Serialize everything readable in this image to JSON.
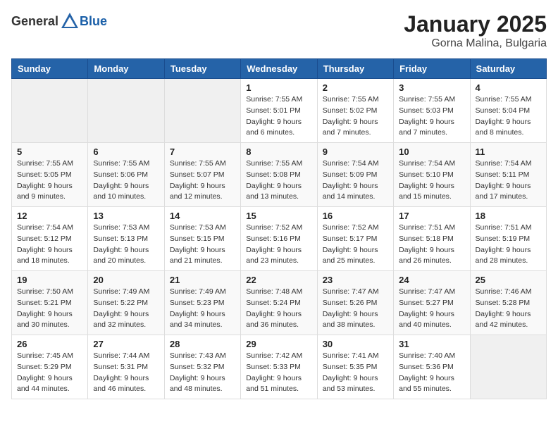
{
  "logo": {
    "general": "General",
    "blue": "Blue"
  },
  "header": {
    "month": "January 2025",
    "location": "Gorna Malina, Bulgaria"
  },
  "weekdays": [
    "Sunday",
    "Monday",
    "Tuesday",
    "Wednesday",
    "Thursday",
    "Friday",
    "Saturday"
  ],
  "weeks": [
    [
      {
        "day": "",
        "sunrise": "",
        "sunset": "",
        "daylight": ""
      },
      {
        "day": "",
        "sunrise": "",
        "sunset": "",
        "daylight": ""
      },
      {
        "day": "",
        "sunrise": "",
        "sunset": "",
        "daylight": ""
      },
      {
        "day": "1",
        "sunrise": "Sunrise: 7:55 AM",
        "sunset": "Sunset: 5:01 PM",
        "daylight": "Daylight: 9 hours and 6 minutes."
      },
      {
        "day": "2",
        "sunrise": "Sunrise: 7:55 AM",
        "sunset": "Sunset: 5:02 PM",
        "daylight": "Daylight: 9 hours and 7 minutes."
      },
      {
        "day": "3",
        "sunrise": "Sunrise: 7:55 AM",
        "sunset": "Sunset: 5:03 PM",
        "daylight": "Daylight: 9 hours and 7 minutes."
      },
      {
        "day": "4",
        "sunrise": "Sunrise: 7:55 AM",
        "sunset": "Sunset: 5:04 PM",
        "daylight": "Daylight: 9 hours and 8 minutes."
      }
    ],
    [
      {
        "day": "5",
        "sunrise": "Sunrise: 7:55 AM",
        "sunset": "Sunset: 5:05 PM",
        "daylight": "Daylight: 9 hours and 9 minutes."
      },
      {
        "day": "6",
        "sunrise": "Sunrise: 7:55 AM",
        "sunset": "Sunset: 5:06 PM",
        "daylight": "Daylight: 9 hours and 10 minutes."
      },
      {
        "day": "7",
        "sunrise": "Sunrise: 7:55 AM",
        "sunset": "Sunset: 5:07 PM",
        "daylight": "Daylight: 9 hours and 12 minutes."
      },
      {
        "day": "8",
        "sunrise": "Sunrise: 7:55 AM",
        "sunset": "Sunset: 5:08 PM",
        "daylight": "Daylight: 9 hours and 13 minutes."
      },
      {
        "day": "9",
        "sunrise": "Sunrise: 7:54 AM",
        "sunset": "Sunset: 5:09 PM",
        "daylight": "Daylight: 9 hours and 14 minutes."
      },
      {
        "day": "10",
        "sunrise": "Sunrise: 7:54 AM",
        "sunset": "Sunset: 5:10 PM",
        "daylight": "Daylight: 9 hours and 15 minutes."
      },
      {
        "day": "11",
        "sunrise": "Sunrise: 7:54 AM",
        "sunset": "Sunset: 5:11 PM",
        "daylight": "Daylight: 9 hours and 17 minutes."
      }
    ],
    [
      {
        "day": "12",
        "sunrise": "Sunrise: 7:54 AM",
        "sunset": "Sunset: 5:12 PM",
        "daylight": "Daylight: 9 hours and 18 minutes."
      },
      {
        "day": "13",
        "sunrise": "Sunrise: 7:53 AM",
        "sunset": "Sunset: 5:13 PM",
        "daylight": "Daylight: 9 hours and 20 minutes."
      },
      {
        "day": "14",
        "sunrise": "Sunrise: 7:53 AM",
        "sunset": "Sunset: 5:15 PM",
        "daylight": "Daylight: 9 hours and 21 minutes."
      },
      {
        "day": "15",
        "sunrise": "Sunrise: 7:52 AM",
        "sunset": "Sunset: 5:16 PM",
        "daylight": "Daylight: 9 hours and 23 minutes."
      },
      {
        "day": "16",
        "sunrise": "Sunrise: 7:52 AM",
        "sunset": "Sunset: 5:17 PM",
        "daylight": "Daylight: 9 hours and 25 minutes."
      },
      {
        "day": "17",
        "sunrise": "Sunrise: 7:51 AM",
        "sunset": "Sunset: 5:18 PM",
        "daylight": "Daylight: 9 hours and 26 minutes."
      },
      {
        "day": "18",
        "sunrise": "Sunrise: 7:51 AM",
        "sunset": "Sunset: 5:19 PM",
        "daylight": "Daylight: 9 hours and 28 minutes."
      }
    ],
    [
      {
        "day": "19",
        "sunrise": "Sunrise: 7:50 AM",
        "sunset": "Sunset: 5:21 PM",
        "daylight": "Daylight: 9 hours and 30 minutes."
      },
      {
        "day": "20",
        "sunrise": "Sunrise: 7:49 AM",
        "sunset": "Sunset: 5:22 PM",
        "daylight": "Daylight: 9 hours and 32 minutes."
      },
      {
        "day": "21",
        "sunrise": "Sunrise: 7:49 AM",
        "sunset": "Sunset: 5:23 PM",
        "daylight": "Daylight: 9 hours and 34 minutes."
      },
      {
        "day": "22",
        "sunrise": "Sunrise: 7:48 AM",
        "sunset": "Sunset: 5:24 PM",
        "daylight": "Daylight: 9 hours and 36 minutes."
      },
      {
        "day": "23",
        "sunrise": "Sunrise: 7:47 AM",
        "sunset": "Sunset: 5:26 PM",
        "daylight": "Daylight: 9 hours and 38 minutes."
      },
      {
        "day": "24",
        "sunrise": "Sunrise: 7:47 AM",
        "sunset": "Sunset: 5:27 PM",
        "daylight": "Daylight: 9 hours and 40 minutes."
      },
      {
        "day": "25",
        "sunrise": "Sunrise: 7:46 AM",
        "sunset": "Sunset: 5:28 PM",
        "daylight": "Daylight: 9 hours and 42 minutes."
      }
    ],
    [
      {
        "day": "26",
        "sunrise": "Sunrise: 7:45 AM",
        "sunset": "Sunset: 5:29 PM",
        "daylight": "Daylight: 9 hours and 44 minutes."
      },
      {
        "day": "27",
        "sunrise": "Sunrise: 7:44 AM",
        "sunset": "Sunset: 5:31 PM",
        "daylight": "Daylight: 9 hours and 46 minutes."
      },
      {
        "day": "28",
        "sunrise": "Sunrise: 7:43 AM",
        "sunset": "Sunset: 5:32 PM",
        "daylight": "Daylight: 9 hours and 48 minutes."
      },
      {
        "day": "29",
        "sunrise": "Sunrise: 7:42 AM",
        "sunset": "Sunset: 5:33 PM",
        "daylight": "Daylight: 9 hours and 51 minutes."
      },
      {
        "day": "30",
        "sunrise": "Sunrise: 7:41 AM",
        "sunset": "Sunset: 5:35 PM",
        "daylight": "Daylight: 9 hours and 53 minutes."
      },
      {
        "day": "31",
        "sunrise": "Sunrise: 7:40 AM",
        "sunset": "Sunset: 5:36 PM",
        "daylight": "Daylight: 9 hours and 55 minutes."
      },
      {
        "day": "",
        "sunrise": "",
        "sunset": "",
        "daylight": ""
      }
    ]
  ]
}
